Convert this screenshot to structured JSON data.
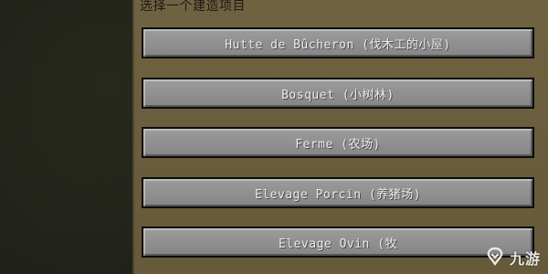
{
  "panel": {
    "title": "选择一个建造项目"
  },
  "options": [
    {
      "label": "Hutte de Bûcheron (伐木工的小屋)"
    },
    {
      "label": "Bosquet (小树林)"
    },
    {
      "label": "Ferme (农场)"
    },
    {
      "label": "Elevage Porcin (养猪场)"
    },
    {
      "label": "Elevage Ovin (牧"
    }
  ],
  "watermark": {
    "text": "九游",
    "icon": "jiuyou-logo-icon"
  }
}
